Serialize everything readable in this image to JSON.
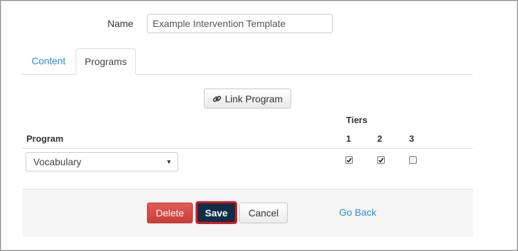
{
  "form": {
    "name_label": "Name",
    "name_value": "Example Intervention Template"
  },
  "tabs": [
    {
      "label": "Content",
      "active": false
    },
    {
      "label": "Programs",
      "active": true
    }
  ],
  "programs": {
    "link_button_label": "Link Program",
    "link_icon": "link-icon",
    "tiers_header": "Tiers",
    "program_header": "Program",
    "tier_columns": [
      "1",
      "2",
      "3"
    ],
    "rows": [
      {
        "program": "Vocabulary",
        "tiers": [
          true,
          true,
          false
        ]
      }
    ]
  },
  "footer": {
    "delete_label": "Delete",
    "save_label": "Save",
    "cancel_label": "Cancel",
    "go_back_label": "Go Back"
  },
  "colors": {
    "link": "#2a8fcf",
    "delete": "#d9534f",
    "save": "#0e2f47",
    "save_highlight": "#e0141f"
  }
}
